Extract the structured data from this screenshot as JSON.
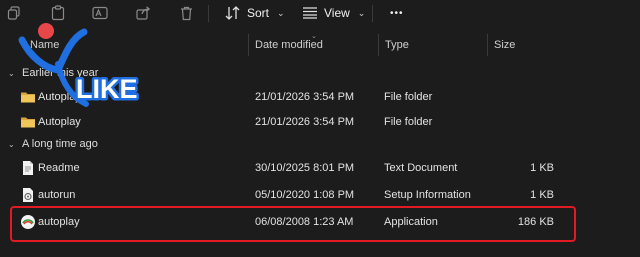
{
  "toolbar": {
    "sort_label": "Sort",
    "view_label": "View",
    "more_label": "•••"
  },
  "columns": {
    "name": "Name",
    "date_modified": "Date modified",
    "type": "Type",
    "size": "Size"
  },
  "groups": [
    {
      "label": "Earlier this year",
      "rows": [
        {
          "name": "Autoplay 2026",
          "date": "21/01/2026 3:54 PM",
          "type": "File folder",
          "size": "",
          "icon": "folder-icon"
        },
        {
          "name": "Autoplay",
          "date": "21/01/2026 3:54 PM",
          "type": "File folder",
          "size": "",
          "icon": "folder-icon"
        }
      ]
    },
    {
      "label": "A long time ago",
      "rows": [
        {
          "name": "Readme",
          "date": "30/10/2025 8:01 PM",
          "type": "Text Document",
          "size": "1 KB",
          "icon": "text-document-icon"
        },
        {
          "name": "autorun",
          "date": "05/10/2020 1:08 PM",
          "type": "Setup Information",
          "size": "1 KB",
          "icon": "setup-information-icon"
        },
        {
          "name": "autoplay",
          "date": "06/08/2008 1:23 AM",
          "type": "Application",
          "size": "186 KB",
          "icon": "application-icon"
        }
      ]
    }
  ],
  "overlay": {
    "stamp_text": "LIKE",
    "stamp_color": "#1f6fe0",
    "dot_color": "#e8474a"
  },
  "colors": {
    "highlight": "#e01b24",
    "folder": "#e8b84a",
    "background": "#1c1c1c"
  }
}
